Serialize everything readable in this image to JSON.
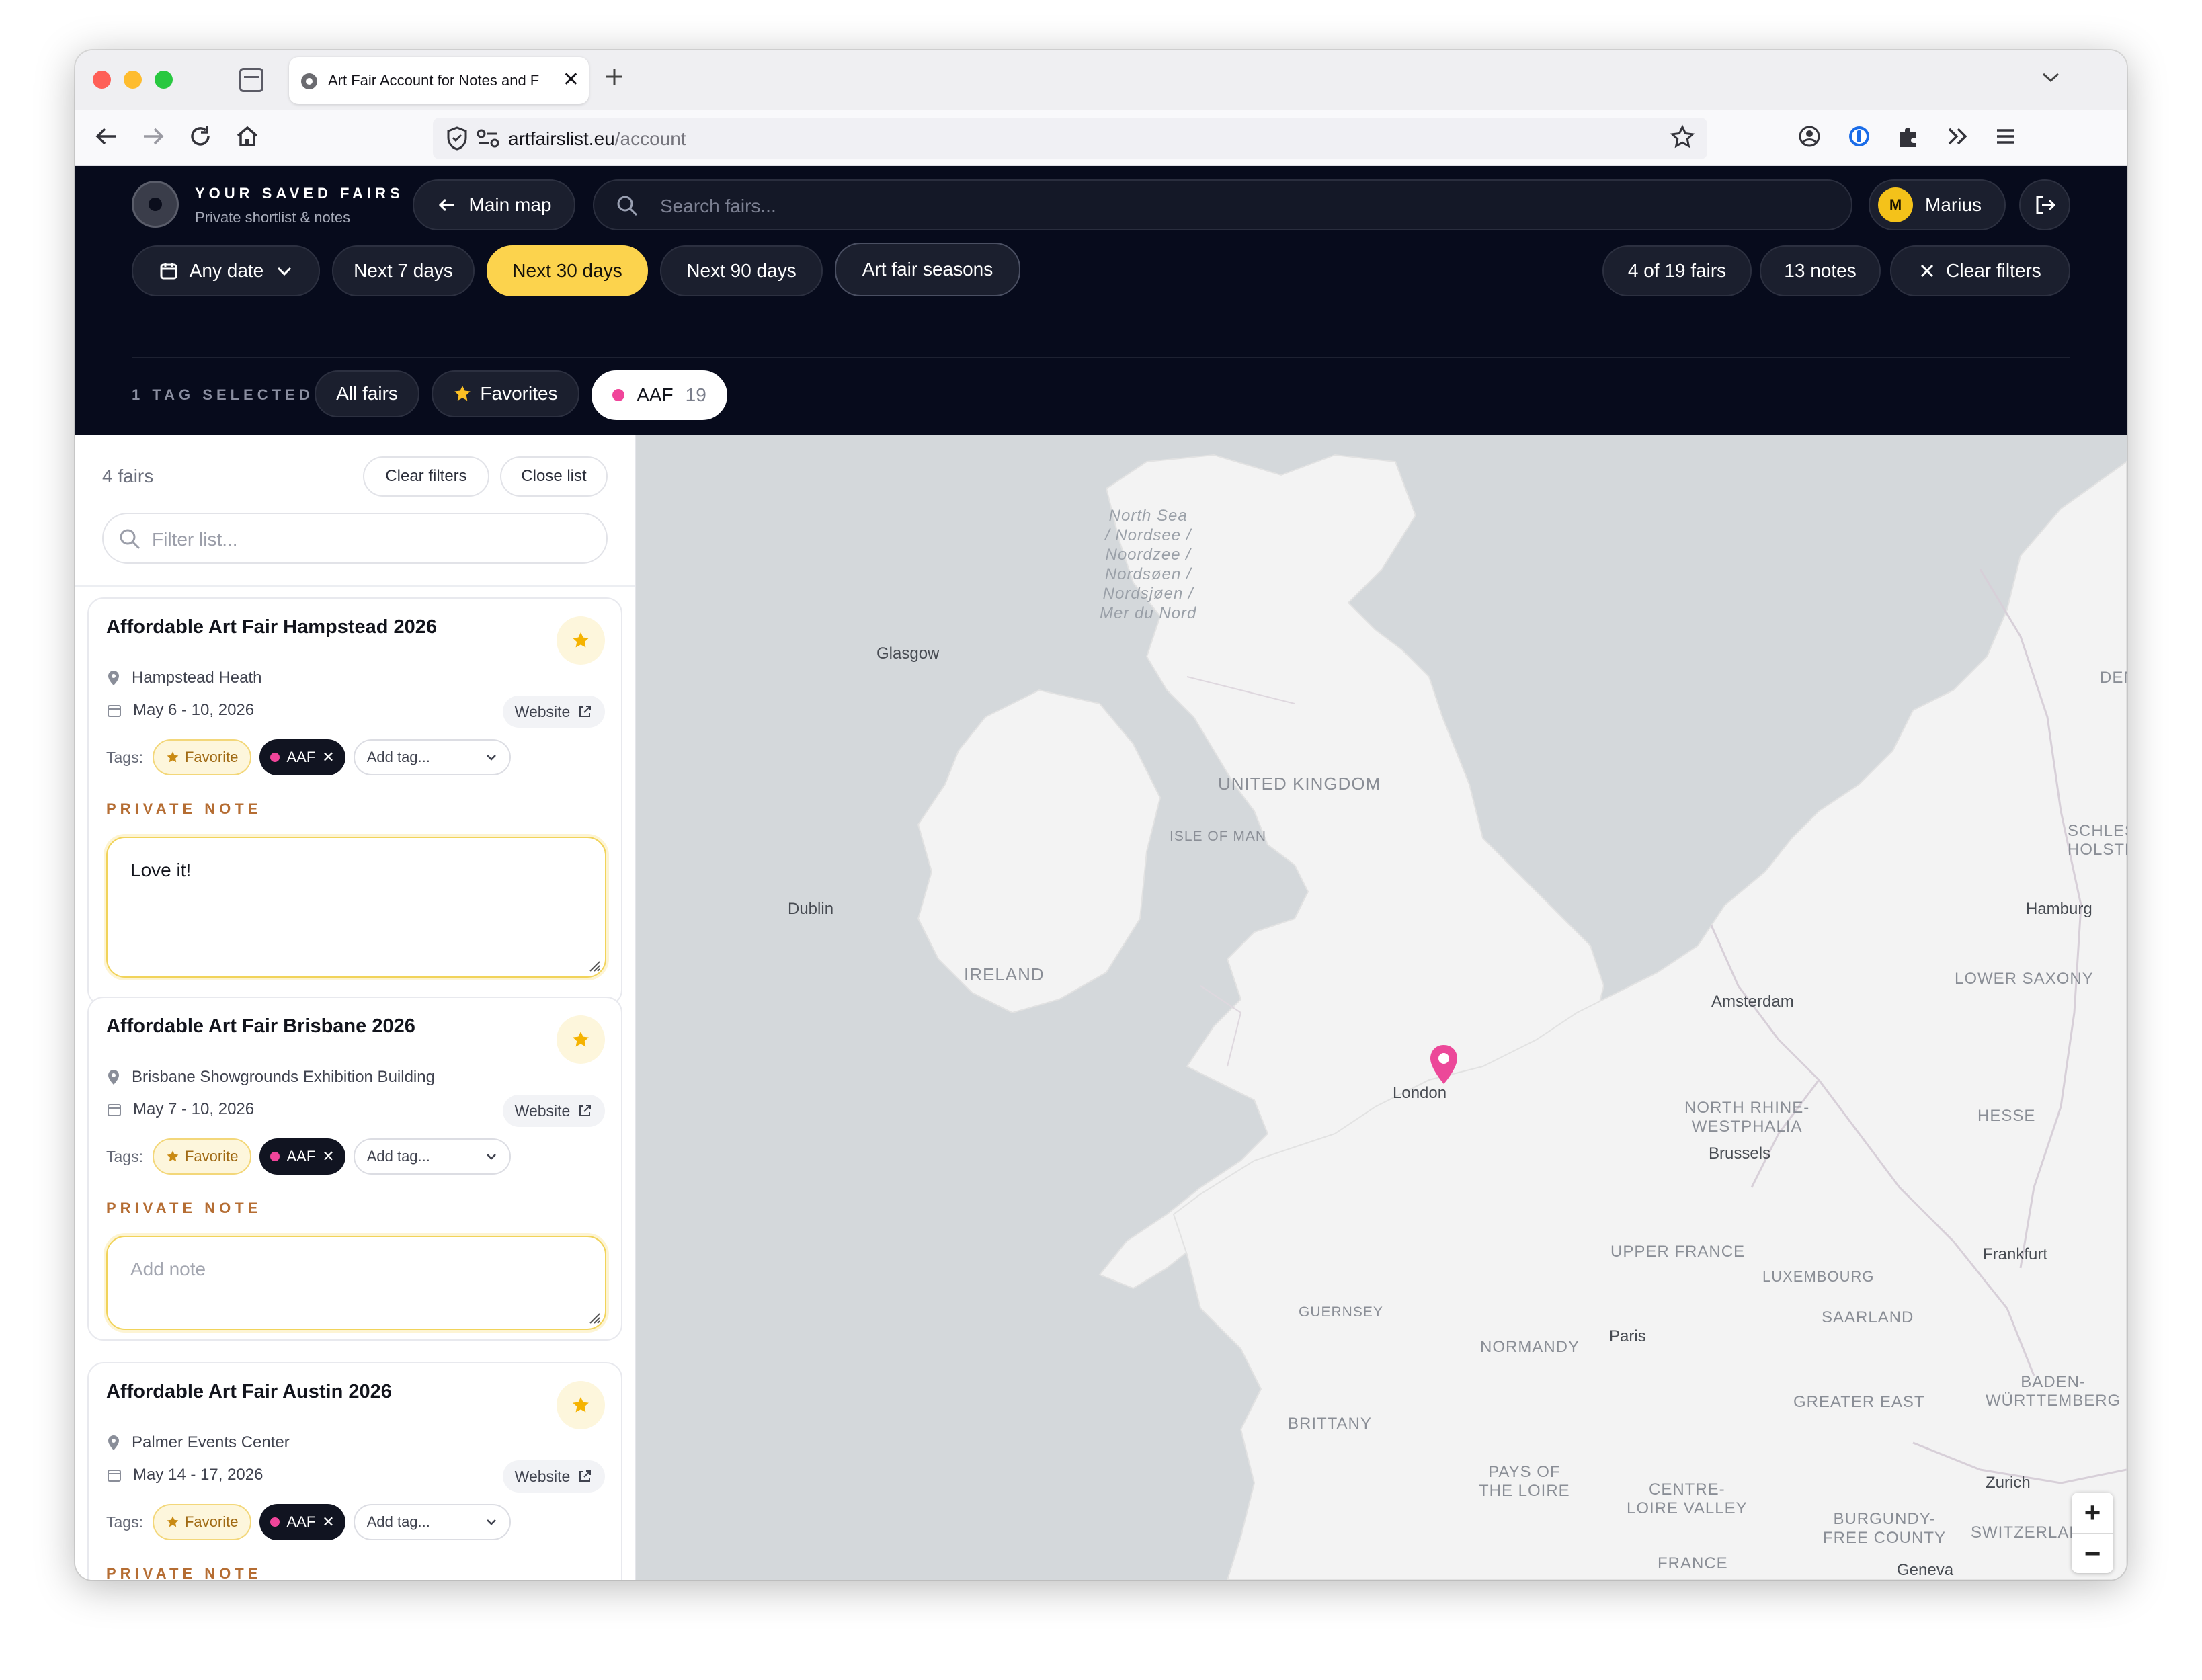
{
  "browser": {
    "tab_title": "Art Fair Account for Notes and F",
    "url_domain": "artfairslist.eu",
    "url_path": "/account",
    "new_tab_icon": "plus-icon"
  },
  "header": {
    "brand_title": "YOUR SAVED FAIRS",
    "brand_subtitle": "Private shortlist & notes",
    "main_map_label": "Main map",
    "search_placeholder": "Search fairs...",
    "user_initial": "M",
    "user_name": "Marius",
    "date_filters": {
      "any_date": "Any date",
      "next7": "Next 7 days",
      "next30": "Next 30 days",
      "next90": "Next 90 days",
      "seasons": "Art fair seasons"
    },
    "fairs_count": "4 of 19 fairs",
    "notes_count": "13 notes",
    "clear_filters": "Clear filters",
    "tags_label": "1 TAG SELECTED",
    "tag_all": "All fairs",
    "tag_favorites": "Favorites",
    "tag_aaf": "AAF",
    "tag_aaf_count": "19",
    "accent_color": "#fcd34d",
    "tag_aaf_color": "#f0459a"
  },
  "sidebar": {
    "count": "4 fairs",
    "clear_filters": "Clear filters",
    "close_list": "Close list",
    "filter_placeholder": "Filter list...",
    "tags_prefix": "Tags:",
    "favorite_chip": "Favorite",
    "aaf_chip": "AAF",
    "add_tag": "Add tag...",
    "website": "Website",
    "note_label": "PRIVATE NOTE",
    "note_placeholder": "Add note",
    "cards": [
      {
        "title": "Affordable Art Fair Hampstead 2026",
        "venue": "Hampstead Heath",
        "dates": "May 6 - 10, 2026",
        "note": "Love it!"
      },
      {
        "title": "Affordable Art Fair Brisbane 2026",
        "venue": "Brisbane Showgrounds Exhibition Building",
        "dates": "May 7 - 10, 2026",
        "note": ""
      },
      {
        "title": "Affordable Art Fair Austin 2026",
        "venue": "Palmer Events Center",
        "dates": "May 14 - 17, 2026",
        "note": ""
      }
    ]
  },
  "map": {
    "sea_label": "North Sea\n/ Nordsee /\nNoordzee /\nNordsøen /\nNordsjøen /\nMer du Nord",
    "cities": {
      "glasgow": "Glasgow",
      "dublin": "Dublin",
      "london": "London",
      "amsterdam": "Amsterdam",
      "brussels": "Brussels",
      "paris": "Paris",
      "hamburg": "Hamburg",
      "frankfurt": "Frankfurt",
      "zurich": "Zurich",
      "geneva": "Geneva"
    },
    "regions": {
      "uk": "UNITED KINGDOM",
      "isle_of_man": "ISLE OF MAN",
      "ireland": "IRELAND",
      "den": "DEN",
      "schleswig": "SCHLESW\nHOLSTE",
      "lower_saxony": "LOWER SAXONY",
      "nrw": "NORTH RHINE-\nWESTPHALIA",
      "hesse": "HESSE",
      "upper_france": "UPPER FRANCE",
      "luxembourg": "LUXEMBOURG",
      "saarland": "SAARLAND",
      "guernsey": "GUERNSEY",
      "normandy": "NORMANDY",
      "brittany": "BRITTANY",
      "greater_east": "GREATER EAST",
      "baden": "BADEN-\nWÜRTTEMBERG",
      "pays_loire": "PAYS OF\nTHE LOIRE",
      "centre": "CENTRE-\nLOIRE VALLEY",
      "burgundy": "BURGUNDY-\nFREE COUNTY",
      "switzerland": "SWITZERLAND",
      "france": "FRANCE"
    },
    "marker_color": "#ec4899",
    "zoom_in": "+",
    "zoom_out": "−"
  }
}
